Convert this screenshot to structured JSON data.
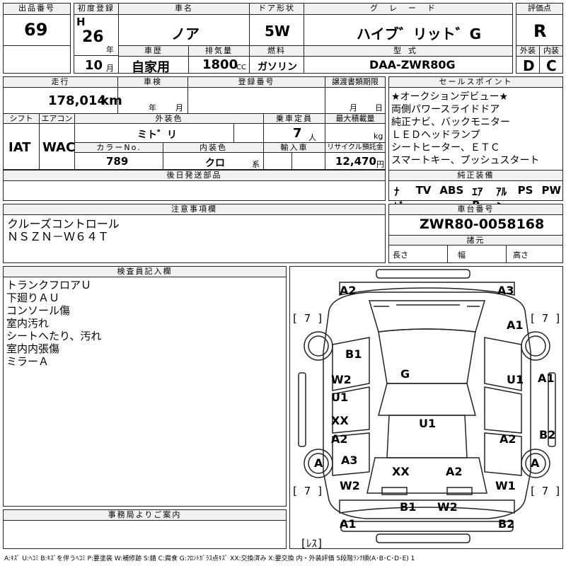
{
  "header": {
    "lot_number_label": "出品番号",
    "lot_number": "69",
    "first_reg_label": "初度登録",
    "era": "H",
    "reg_year": "26",
    "year_unit": "年",
    "reg_month": "10",
    "month_unit": "月",
    "car_name_label": "車名",
    "car_name": "ノア",
    "door_label": "ドア形状",
    "door": "5W",
    "grade_label": "グレード",
    "grade": "ハイブ゛リット゛G",
    "score_label": "評価点",
    "score": "R",
    "history_label": "車歴",
    "history": "自家用",
    "displacement_label": "排気量",
    "displacement": "1800",
    "displacement_unit": "CC",
    "fuel_label": "燃料",
    "fuel": "ガソリン",
    "model_label": "型式",
    "model": "DAA-ZWR80G",
    "exterior_label": "外装",
    "exterior_grade": "D",
    "interior_label": "内装",
    "interior_grade": "C"
  },
  "row2": {
    "mileage_label": "走行",
    "mileage": "178,014",
    "mileage_unit": "km",
    "inspection_label": "車検",
    "inspection_year_unit": "年",
    "inspection_month_unit": "月",
    "reg_no_label": "登録番号",
    "transfer_label": "譲渡書類期限",
    "transfer_month_unit": "月",
    "transfer_day_unit": "日",
    "shift_label": "シフト",
    "shift": "IAT",
    "ac_label": "エアコン",
    "ac": "WAC",
    "color_label": "外装色",
    "color": "ミト゛リ",
    "capacity_label": "乗車定員",
    "capacity": "7",
    "capacity_unit": "人",
    "max_load_label": "最大積載量",
    "max_load_unit": "kg",
    "color_no_label": "カラーNo.",
    "color_no": "789",
    "interior_color_label": "内装色",
    "interior_color": "クロ",
    "interior_unit": "系",
    "import_label": "輸入車",
    "recycle_label": "リサイクル預託金",
    "recycle": "12,470",
    "recycle_unit": "円",
    "later_parts_label": "後日発送部品"
  },
  "sales_points": {
    "label": "セールスポイント",
    "lines": [
      "★オークションデビュー★",
      "両側パワースライドドア",
      "純正ナビ、バックモニター",
      "ＬＥＤヘッドランプ",
      "シートヒーター、ＥＴＣ",
      "スマートキー、プッシュスタート"
    ]
  },
  "equipment": {
    "label": "純正装備",
    "items": [
      "ﾅﾋﾞ",
      "TV",
      "ABS",
      "ｴｱB",
      "ｱﾙﾐ",
      "PS",
      "PW"
    ]
  },
  "notes": {
    "label": "注意事項欄",
    "lines": [
      "クルーズコントロール",
      "ＮＳＺＮ－Ｗ６４Ｔ"
    ]
  },
  "chassis": {
    "label": "車台番号",
    "number": "ZWR80-0058168",
    "specs_label": "諸元",
    "length_label": "長さ",
    "width_label": "幅",
    "height_label": "高さ"
  },
  "inspector": {
    "label": "検査員記入欄",
    "lines": [
      "トランクフロアＵ",
      "下廻りＡＵ",
      "コンソール傷",
      "室内汚れ",
      "シートへたり、汚れ",
      "室内内張傷",
      "ミラーＡ"
    ]
  },
  "office": {
    "label": "事務局よりご案内"
  },
  "diagram": {
    "marks": {
      "a2_tl": "A2",
      "a3_tr": "A3",
      "a1_r": "A1",
      "b1_l": "B1",
      "g": "G",
      "w2_l": "W2",
      "u1_l": "U1",
      "u1_r": "U1",
      "a1_rr": "A1",
      "xx_l": "XX",
      "a2_l": "A2",
      "u1_c": "U1",
      "a2_r": "A2",
      "b2_rr": "B2",
      "a3_l": "A3",
      "a_l": "A",
      "a_r": "A",
      "xx_c": "XX",
      "a2_c": "A2",
      "w2_bl": "W2",
      "w1_br": "W1",
      "b1_b": "B1",
      "w2_b": "W2",
      "a1_bl": "A1",
      "b2_br": "B2"
    },
    "brackets": {
      "tl": "[ 7 ]",
      "tr": "[ 7 ]",
      "bl": "[ 7 ]",
      "br": "[ 7 ]",
      "rest": "[ﾚｽ]"
    }
  },
  "legend": "A:ｷｽﾞ U:ﾍｺﾐ B:ｷｽﾞを伴うﾍｺﾐ P:要塗装 W:補修跡 S:錆 C:腐食 G:ﾌﾛﾝﾄｶﾞﾗｽ点ｷｽﾞ XX:交換済み X:要交換  内・外装評価 5段階ﾗﾝｸ順(A･B･C･D･E) 1"
}
